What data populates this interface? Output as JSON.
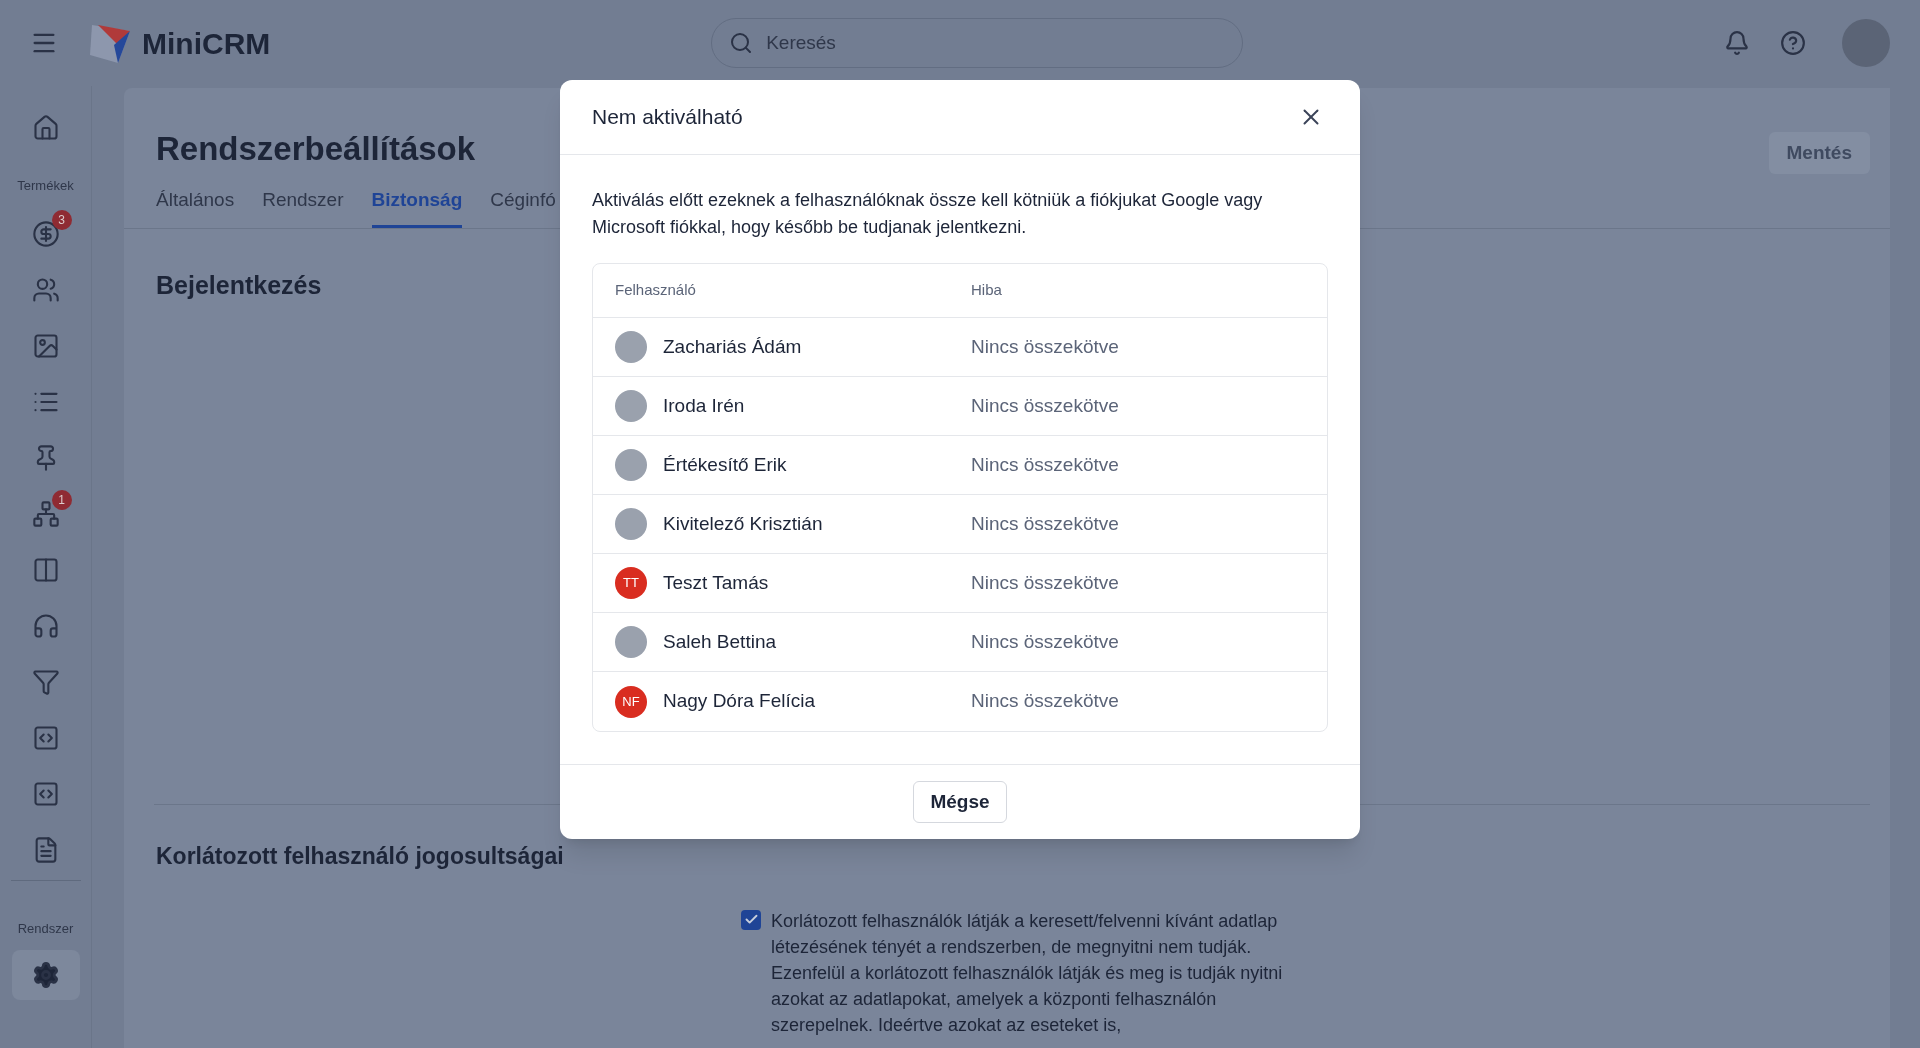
{
  "topbar": {
    "brand": "MiniCRM",
    "search": {
      "placeholder": "Keresés"
    }
  },
  "sidebar": {
    "groups": [
      {
        "items": [
          {
            "selected": false
          }
        ]
      },
      {
        "label": "Termékek",
        "items": [
          {
            "badge": "3",
            "selected": false
          },
          {
            "selected": false
          },
          {
            "selected": false
          },
          {
            "selected": false
          },
          {
            "selected": false
          },
          {
            "badge": "1",
            "selected": false
          },
          {
            "selected": false
          },
          {
            "selected": false
          },
          {
            "selected": false
          },
          {
            "selected": false
          },
          {
            "selected": false
          },
          {
            "selected": false
          }
        ]
      },
      {
        "label": "Rendszer",
        "items": [
          {
            "selected": true
          }
        ]
      }
    ]
  },
  "page": {
    "title": "Rendszerbeállítások",
    "save_button": "Mentés",
    "tabs": [
      {
        "label": "Általános",
        "selected": false
      },
      {
        "label": "Rendszer",
        "selected": false
      },
      {
        "label": "Biztonság",
        "selected": true
      },
      {
        "label": "Céginfó",
        "selected": false
      }
    ],
    "sections": [
      {
        "title": "Bejelentkezés"
      },
      {
        "title": "Korlátozott felhasználó jogosultságai",
        "checkbox": {
          "checked": true,
          "label": "Korlátozott felhasználók látják a keresett/felvenni kívánt adatlap létezésének tényét a rendszerben, de megnyitni nem tudják. Ezenfelül a korlátozott felhasználók látják és meg is tudják nyitni azokat az adatlapokat, amelyek a központi felhasználón szerepelnek. Ideértve azokat az eseteket is,"
        }
      }
    ]
  },
  "modal": {
    "title": "Nem aktiválható",
    "description": "Aktiválás előtt ezeknek a felhasználóknak össze kell kötniük a fiókjukat Google vagy Microsoft fiókkal, hogy később be tudjanak jelentkezni.",
    "columns": [
      "Felhasználó",
      "Hiba"
    ],
    "rows": [
      {
        "name": "Zachariás Ádám",
        "error": "Nincs összekötve"
      },
      {
        "name": "Iroda Irén",
        "error": "Nincs összekötve"
      },
      {
        "name": "Értékesítő Erik",
        "error": "Nincs összekötve"
      },
      {
        "name": "Kivitelező Krisztián",
        "error": "Nincs összekötve"
      },
      {
        "initials": "TT",
        "color": "#d92d20",
        "name": "Teszt Tamás",
        "error": "Nincs összekötve"
      },
      {
        "name": "Saleh Bettina",
        "error": "Nincs összekötve"
      },
      {
        "initials": "NF",
        "color": "#d92d20",
        "name": "Nagy Dóra Felícia",
        "error": "Nincs összekötve"
      }
    ],
    "cancel_button": "Mégse"
  }
}
